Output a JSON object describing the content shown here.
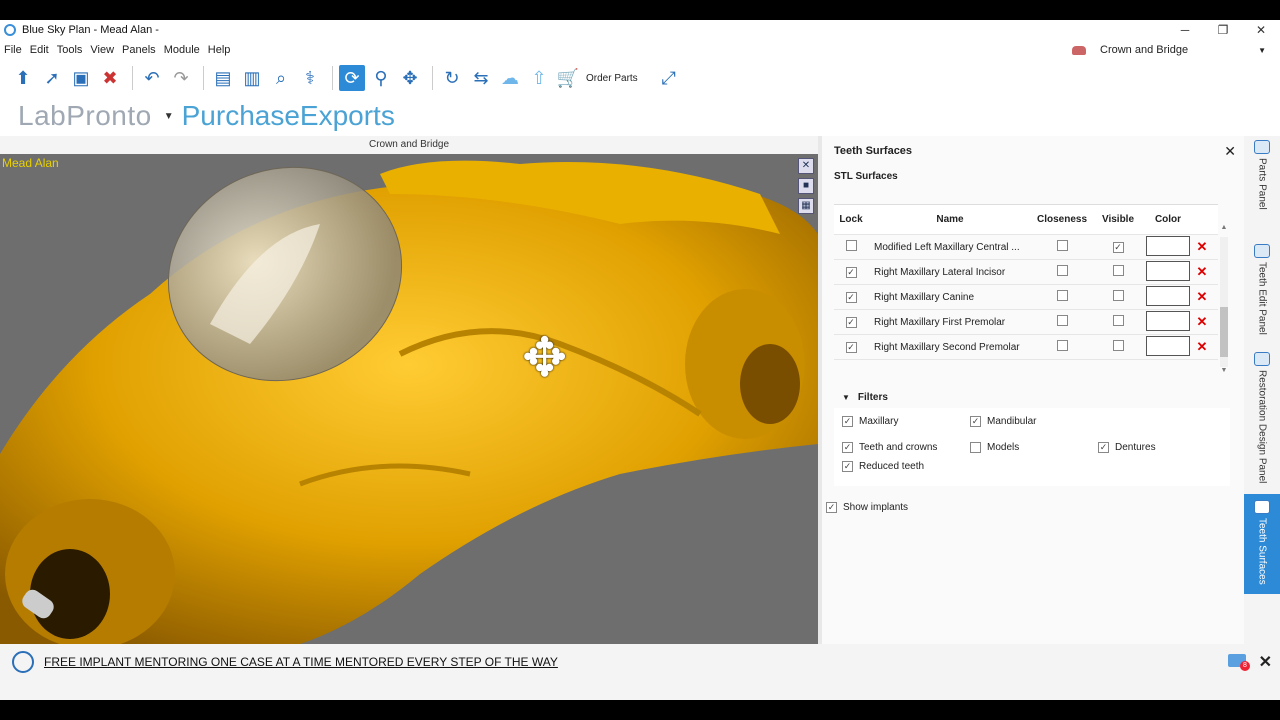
{
  "window": {
    "title": "Blue Sky Plan - Mead Alan -",
    "min": "─",
    "max": "❐",
    "close": "✕"
  },
  "menu": [
    "File",
    "Edit",
    "Tools",
    "View",
    "Panels",
    "Module",
    "Help"
  ],
  "module_selector": "Crown and Bridge",
  "toolbar": {
    "order_parts": "Order Parts"
  },
  "brand": {
    "lab": "LabPronto",
    "purchase": "PurchaseExports"
  },
  "viewport": {
    "header": "Crown and Bridge",
    "patient": "Mead Alan",
    "close_tool": "✕"
  },
  "panel": {
    "title": "Teeth Surfaces",
    "close": "✕",
    "section": "STL Surfaces",
    "columns": [
      "Lock",
      "Name",
      "Closeness",
      "Visible",
      "Color"
    ],
    "rows": [
      {
        "lock": false,
        "name": "Modified Left Maxillary Central ...",
        "closeness": false,
        "visible": true,
        "delete": "✕"
      },
      {
        "lock": true,
        "name": "Right Maxillary Lateral Incisor",
        "closeness": false,
        "visible": false,
        "delete": "✕"
      },
      {
        "lock": true,
        "name": "Right Maxillary Canine",
        "closeness": false,
        "visible": false,
        "delete": "✕"
      },
      {
        "lock": true,
        "name": "Right Maxillary First Premolar",
        "closeness": false,
        "visible": false,
        "delete": "✕"
      },
      {
        "lock": true,
        "name": "Right Maxillary Second Premolar",
        "closeness": false,
        "visible": false,
        "delete": "✕"
      }
    ],
    "filters_title": "Filters",
    "filters": {
      "maxillary": "Maxillary",
      "mandibular": "Mandibular",
      "teeth_crowns": "Teeth and crowns",
      "models": "Models",
      "dentures": "Dentures",
      "reduced": "Reduced teeth"
    },
    "show_implants": "Show implants"
  },
  "side_tabs": [
    "Parts Panel",
    "Teeth Edit Panel",
    "Restoration Design Panel",
    "Teeth Surfaces"
  ],
  "banner": {
    "text": "FREE IMPLANT MENTORING ONE CASE AT A TIME MENTORED EVERY STEP OF THE WAY",
    "badge": "8",
    "close": "✕"
  },
  "colors": {
    "accent": "#2d8ad6",
    "model": "#e5a700",
    "patient_label": "#e8d000"
  }
}
